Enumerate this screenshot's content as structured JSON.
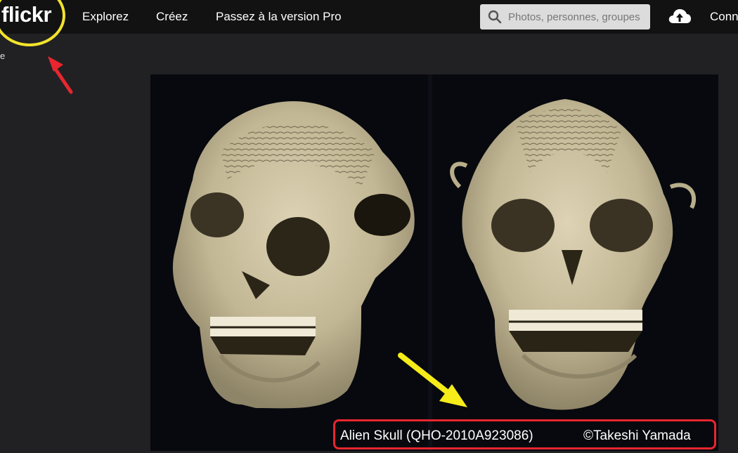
{
  "header": {
    "logo": "flickr",
    "nav": [
      {
        "label": "Explorez"
      },
      {
        "label": "Créez"
      },
      {
        "label": "Passez à la version Pro"
      }
    ],
    "search_placeholder": "Photos, personnes, groupes",
    "login_label": "Conn"
  },
  "sidebar": {
    "text": "e"
  },
  "photo": {
    "caption_title": "Alien Skull (QHO-2010A923086)",
    "caption_credit": "©Takeshi Yamada"
  },
  "colors": {
    "header_bg": "#121212",
    "page_bg": "#212124",
    "annotation_circle": "#f3e32b",
    "annotation_arrow_red": "#e8262f",
    "annotation_arrow_yellow": "#f5ec1a",
    "caption_box": "#e8262f"
  }
}
